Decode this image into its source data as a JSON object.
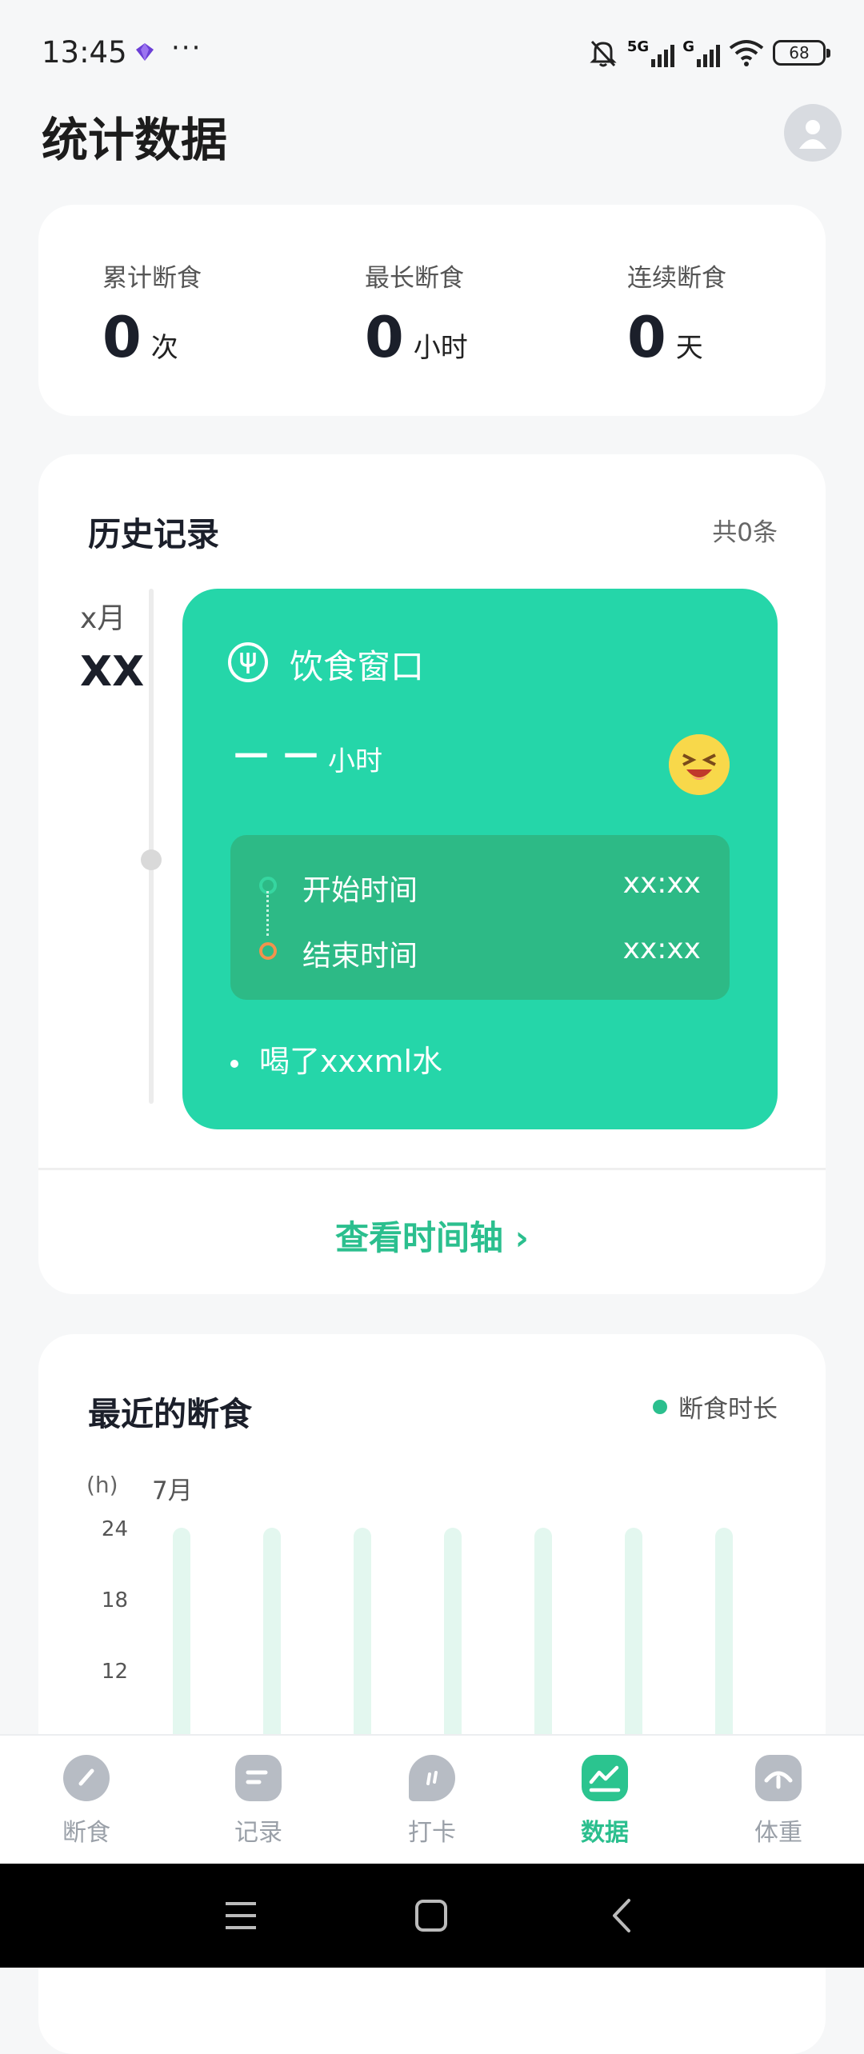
{
  "status_bar": {
    "time": "13:45",
    "more": "···",
    "signal_1_label": "5G",
    "signal_2_label": "G",
    "battery": "68"
  },
  "header": {
    "title": "统计数据"
  },
  "stats": [
    {
      "label": "累计断食",
      "value": "0",
      "unit": "次"
    },
    {
      "label": "最长断食",
      "value": "0",
      "unit": "小时"
    },
    {
      "label": "连续断食",
      "value": "0",
      "unit": "天"
    }
  ],
  "history": {
    "title": "历史记录",
    "count": "共0条",
    "month": "x月",
    "day": "XX",
    "entry": {
      "title": "饮食窗口",
      "hours_placeholder": "－－",
      "hours_unit": "小时",
      "start_label": "开始时间",
      "start_value": "xx:xx",
      "end_label": "结束时间",
      "end_value": "xx:xx",
      "water": "喝了xxxml水"
    },
    "link": "查看时间轴 ›"
  },
  "recent": {
    "title": "最近的断食",
    "legend": "断食时长",
    "y_unit": "(h)",
    "month": "7月",
    "colors": {
      "bar": "#e3f7ef",
      "accent": "#2bbf8e"
    }
  },
  "chart_data": {
    "type": "bar",
    "title": "最近的断食",
    "ylabel": "(h)",
    "xlabel": "7月",
    "yticks": [
      24,
      18,
      12
    ],
    "series": [
      {
        "name": "断食时长",
        "values": [
          0,
          0,
          0,
          0,
          0,
          0,
          0
        ]
      }
    ],
    "ylim": [
      0,
      24
    ]
  },
  "nav": [
    {
      "label": "断食",
      "icon": "gauge-icon",
      "active": false
    },
    {
      "label": "记录",
      "icon": "notes-icon",
      "active": false
    },
    {
      "label": "打卡",
      "icon": "chat-icon",
      "active": false
    },
    {
      "label": "数据",
      "icon": "chart-icon",
      "active": true
    },
    {
      "label": "体重",
      "icon": "scale-icon",
      "active": false
    }
  ]
}
